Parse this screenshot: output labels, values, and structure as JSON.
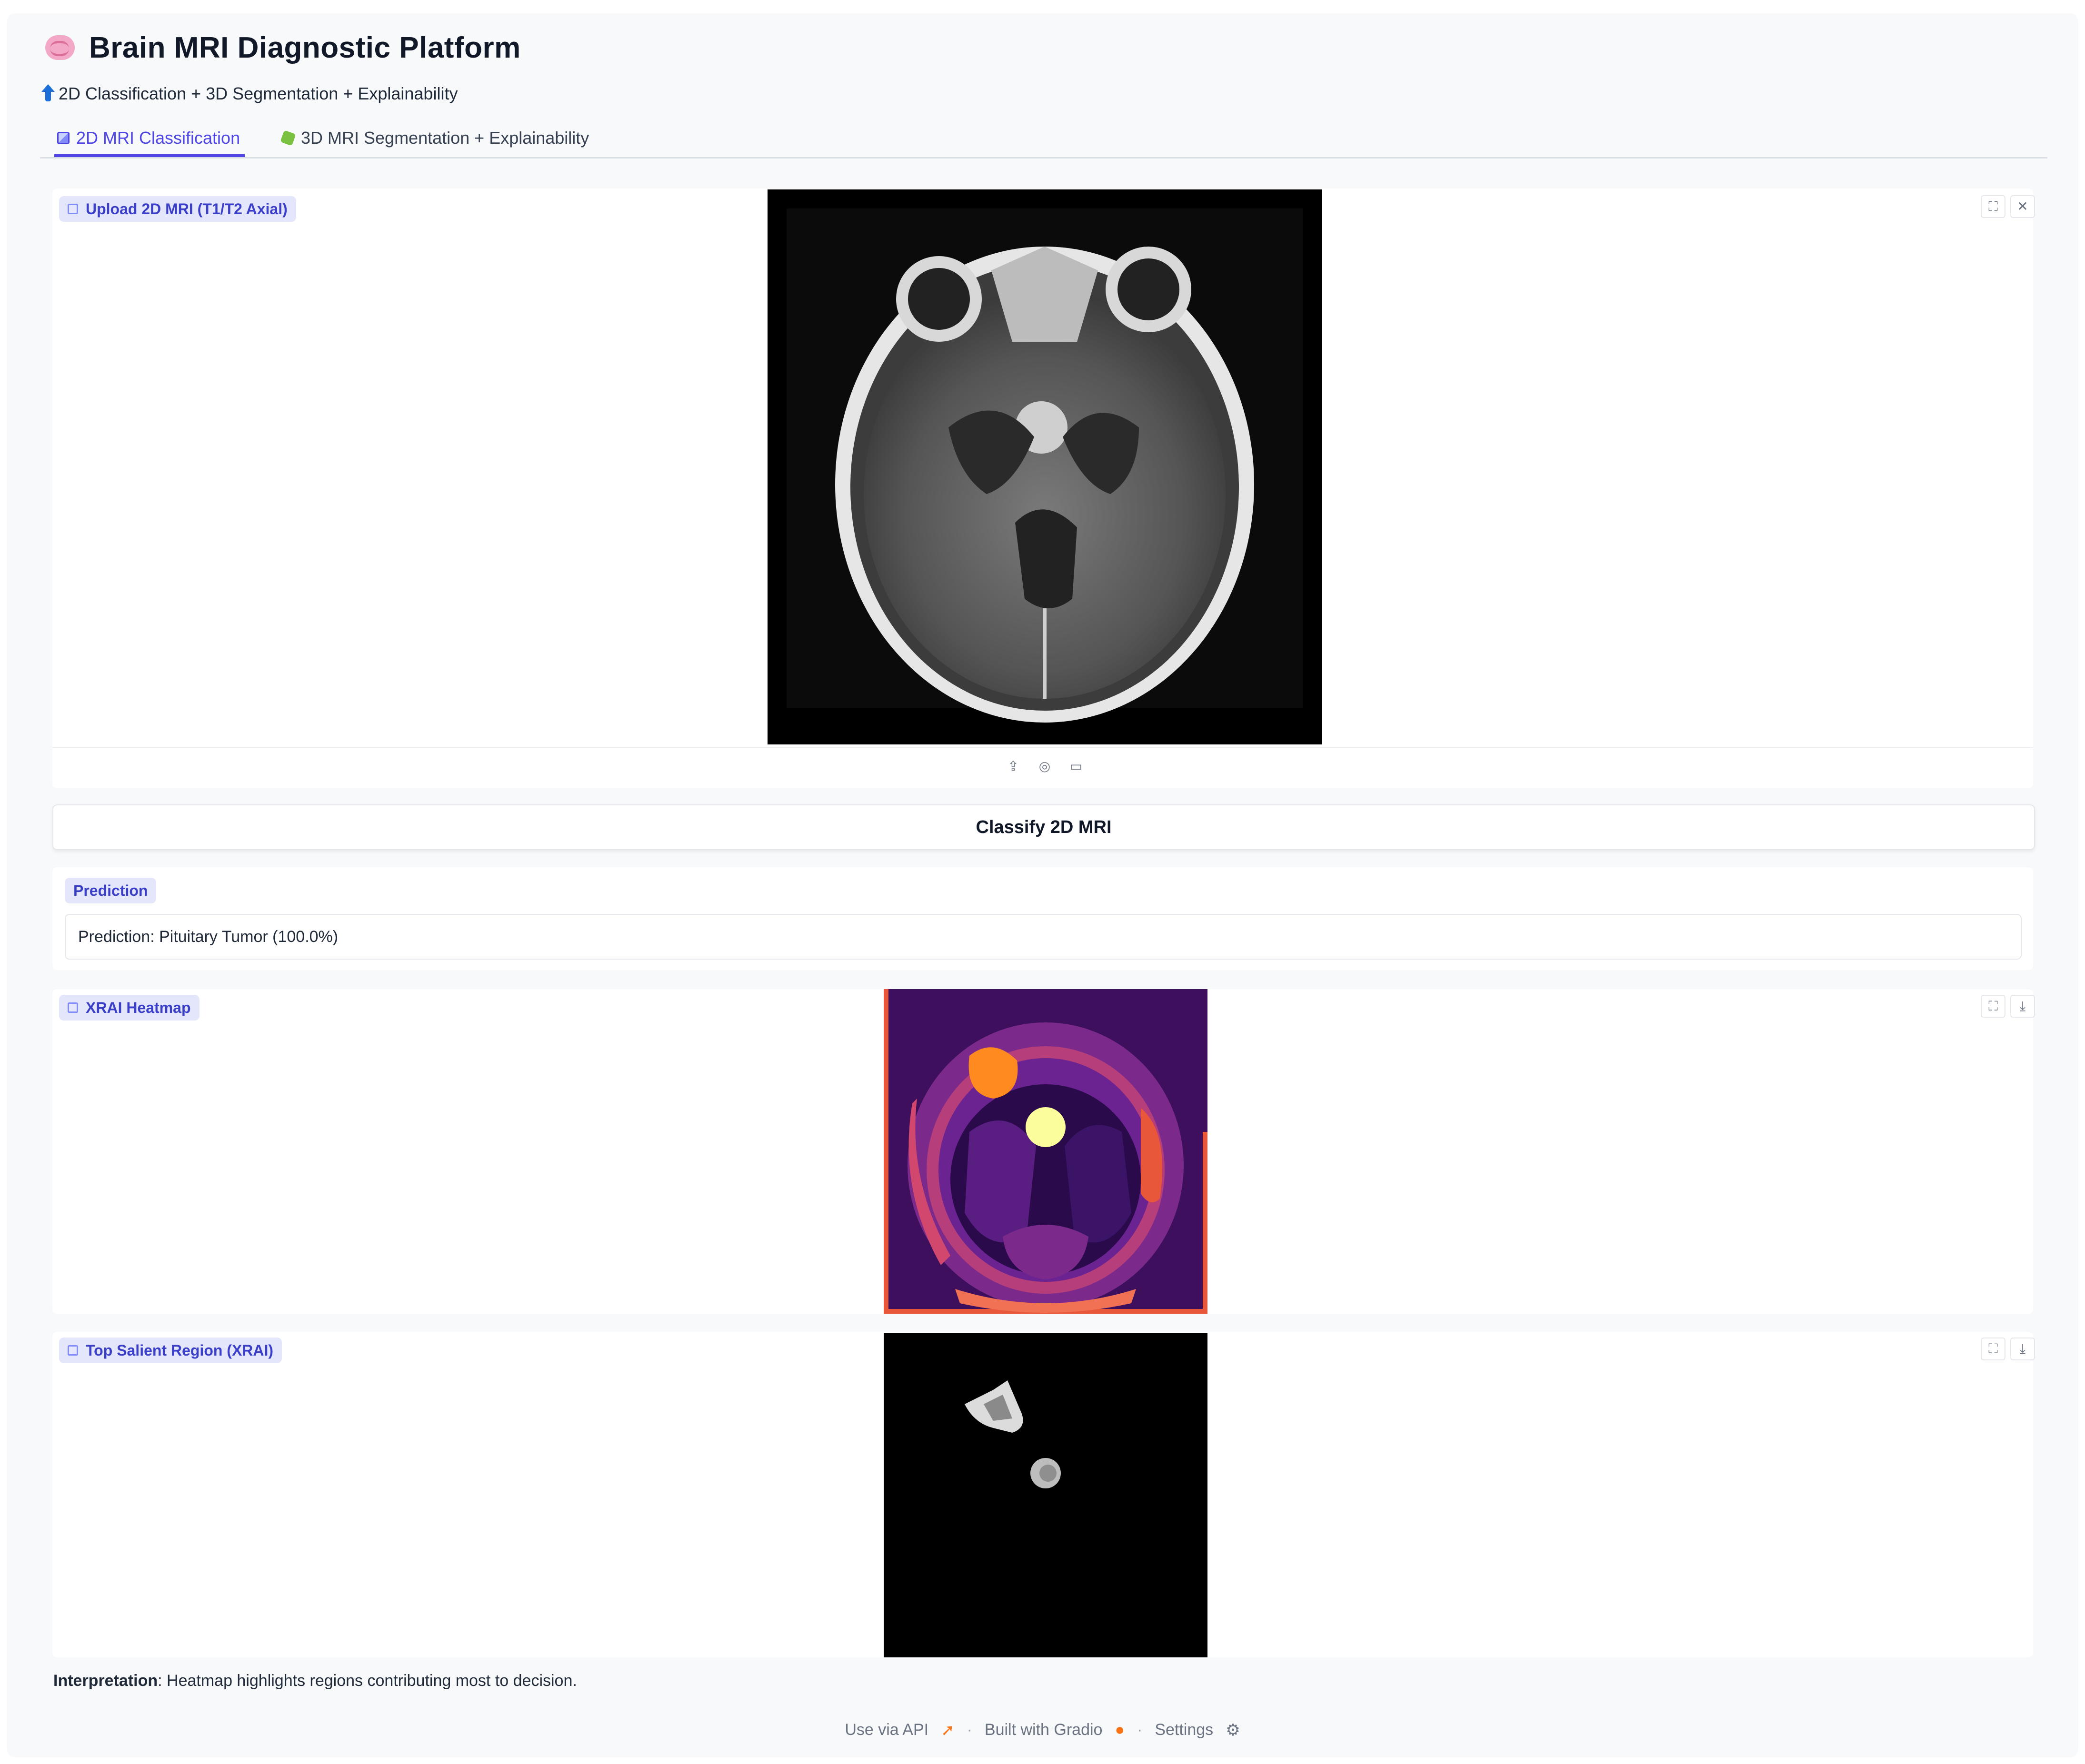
{
  "header": {
    "icon": "brain-icon",
    "title": "Brain MRI Diagnostic Platform",
    "subtitle": "2D Classification + 3D Segmentation + Explainability"
  },
  "tabs": [
    {
      "label": "2D MRI Classification",
      "icon": "image-icon",
      "active": true
    },
    {
      "label": "3D MRI Segmentation + Explainability",
      "icon": "puzzle-icon",
      "active": false
    }
  ],
  "upload": {
    "label": "Upload 2D MRI (T1/T2 Axial)",
    "source_icons": [
      "upload-icon",
      "webcam-icon",
      "clipboard-icon"
    ]
  },
  "classify_button": "Classify 2D MRI",
  "prediction": {
    "label": "Prediction",
    "text": "Prediction: Pituitary Tumor (100.0%)"
  },
  "heatmap": {
    "label": "XRAI Heatmap"
  },
  "salient": {
    "label": "Top Salient Region (XRAI)"
  },
  "interpretation": {
    "bold": "Interpretation",
    "text": ": Heatmap highlights regions contributing most to decision."
  },
  "footer": {
    "api": "Use via API",
    "built": "Built with Gradio",
    "settings": "Settings",
    "separator": "·"
  },
  "colors": {
    "accent": "#4f46e5",
    "chip_bg": "#e4e7fb",
    "page_bg": "#f7f9fb"
  }
}
